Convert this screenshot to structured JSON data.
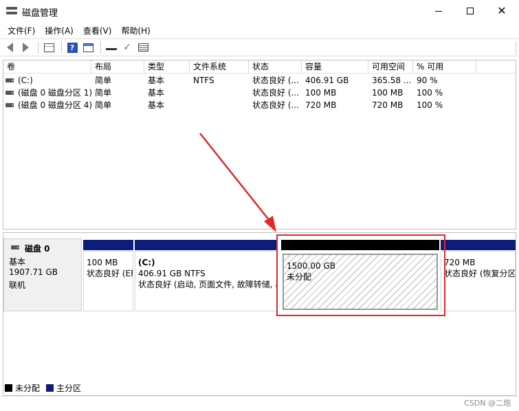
{
  "window": {
    "title": "磁盘管理",
    "close_glyph": "✕"
  },
  "menu": [
    "文件(F)",
    "操作(A)",
    "查看(V)",
    "帮助(H)"
  ],
  "toolbar": {
    "help_glyph": "?",
    "check_glyph": "✓",
    "icons": [
      "back-arrow-icon",
      "forward-arrow-icon",
      "volume-list-icon",
      "help-icon",
      "window-icon",
      "connect-icon",
      "checkmark-icon",
      "properties-icon"
    ]
  },
  "volume_list": {
    "columns": [
      "卷",
      "布局",
      "类型",
      "文件系统",
      "状态",
      "容量",
      "可用空间",
      "% 可用"
    ],
    "rows": [
      [
        "(C:)",
        "简单",
        "基本",
        "NTFS",
        "状态良好 (...",
        "406.91 GB",
        "365.58 ...",
        "90 %"
      ],
      [
        "(磁盘 0 磁盘分区 1)",
        "简单",
        "基本",
        "",
        "状态良好 (...",
        "100 MB",
        "100 MB",
        "100 %"
      ],
      [
        "(磁盘 0 磁盘分区 4)",
        "简单",
        "基本",
        "",
        "状态良好 (...",
        "720 MB",
        "720 MB",
        "100 %"
      ]
    ]
  },
  "disk": {
    "name": "磁盘 0",
    "type": "基本",
    "size": "1907.71 GB",
    "status": "联机"
  },
  "partitions": [
    {
      "name": "",
      "size": "100 MB",
      "status": "状态良好 (EFI 系统分区)",
      "kind": "primary"
    },
    {
      "name": "(C:)",
      "size": "406.91 GB NTFS",
      "status": "状态良好 (启动, 页面文件, 故障转储, 基本数据分区)",
      "kind": "primary"
    },
    {
      "name": "",
      "size": "1500.00 GB",
      "status": "未分配",
      "kind": "unallocated"
    },
    {
      "name": "",
      "size": "720 MB",
      "status": "状态良好 (恢复分区)",
      "kind": "primary"
    }
  ],
  "legend": [
    {
      "label": "未分配",
      "color": "#000000"
    },
    {
      "label": "主分区",
      "color": "#0c1d7b"
    }
  ],
  "colors": {
    "primary": "#0c1d7b",
    "unallocated": "#000000",
    "highlight": "#e2272b"
  },
  "watermark": "CSDN @二炮"
}
